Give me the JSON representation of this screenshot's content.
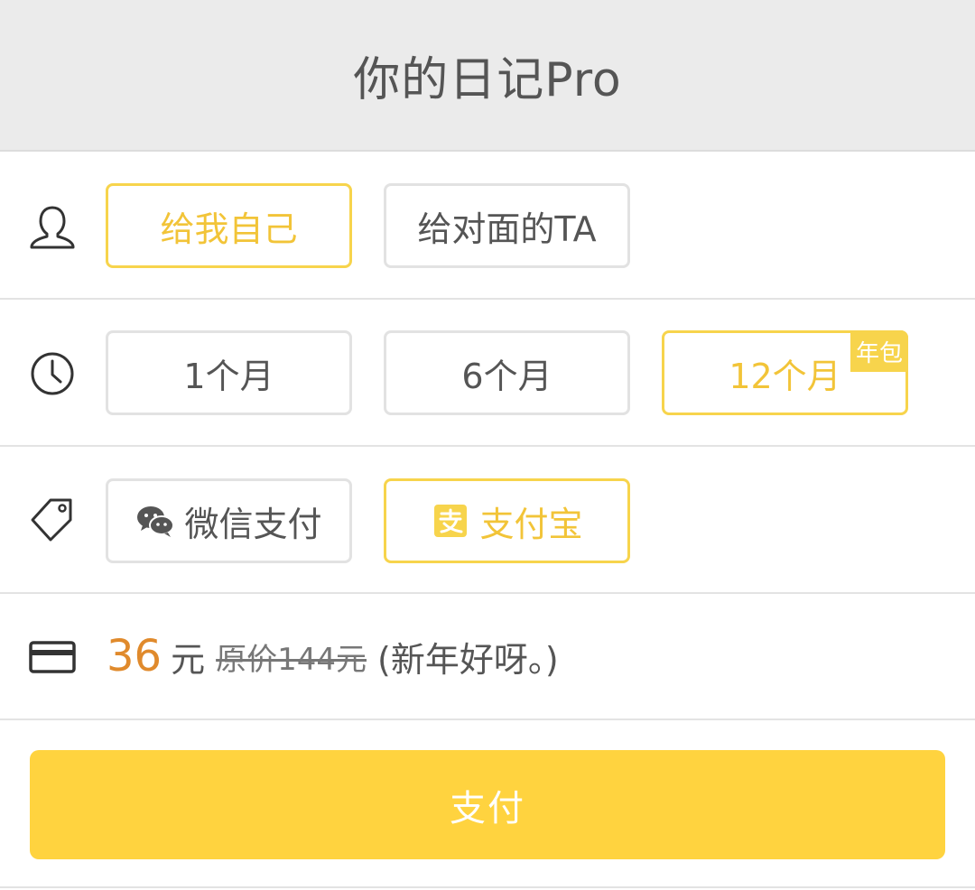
{
  "header": {
    "title": "你的日记Pro"
  },
  "recipient": {
    "icon": "user-icon",
    "options": [
      {
        "label": "给我自己",
        "selected": true
      },
      {
        "label": "给对面的TA",
        "selected": false
      }
    ]
  },
  "duration": {
    "icon": "clock-icon",
    "options": [
      {
        "label": "1个月",
        "selected": false
      },
      {
        "label": "6个月",
        "selected": false
      },
      {
        "label": "12个月",
        "selected": true,
        "badge": "年包"
      }
    ]
  },
  "payment": {
    "icon": "tag-icon",
    "options": [
      {
        "label": "微信支付",
        "icon": "wechat-icon",
        "selected": false
      },
      {
        "label": "支付宝",
        "icon": "alipay-icon",
        "selected": true
      }
    ]
  },
  "price": {
    "icon": "credit-card-icon",
    "amount": "36",
    "unit": "元",
    "original": "原价144元",
    "note": "(新年好呀。)"
  },
  "pay_button": {
    "label": "支付"
  },
  "colors": {
    "accent": "#f7d44c",
    "accent_text": "#f2c438",
    "price": "#e08a2c",
    "button": "#ffd33f"
  }
}
